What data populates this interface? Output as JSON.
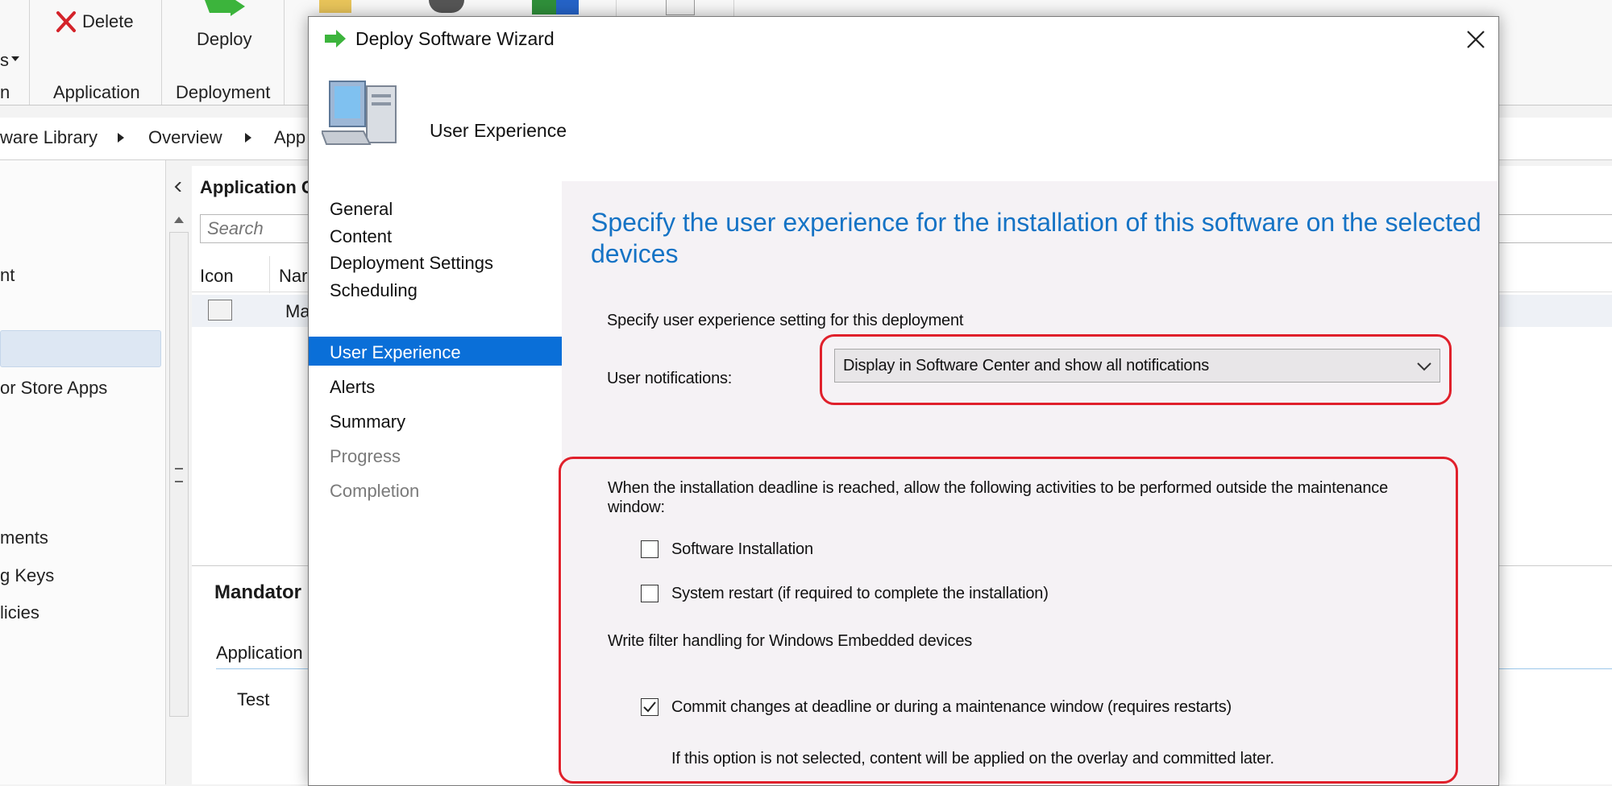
{
  "console": {
    "ribbon": {
      "delete_label": "Delete",
      "deploy_label": "Deploy",
      "left_edge_label": "s",
      "group_left": "n",
      "group_application": "Application",
      "group_deployment": "Deployment"
    },
    "breadcrumb": {
      "item1": "ware Library",
      "item2": "Overview",
      "item3": "App"
    },
    "nav": {
      "items": [
        "nt",
        "or Store Apps",
        "ments",
        "g Keys",
        "licies"
      ]
    },
    "list": {
      "title": "Application C",
      "search_placeholder": "Search",
      "col_icon": "Icon",
      "col_name": "Nar",
      "row_name": "Ma",
      "detail_title": "Mandator",
      "detail_tab": "Application",
      "detail_value": "Test"
    }
  },
  "wizard": {
    "title": "Deploy Software Wizard",
    "header_title": "User Experience",
    "steps": [
      {
        "label": "General",
        "state": "done"
      },
      {
        "label": "Content",
        "state": "done"
      },
      {
        "label": "Deployment Settings",
        "state": "done"
      },
      {
        "label": "Scheduling",
        "state": "done"
      },
      {
        "label": "User Experience",
        "state": "current"
      },
      {
        "label": "Alerts",
        "state": "pending"
      },
      {
        "label": "Summary",
        "state": "pending"
      },
      {
        "label": "Progress",
        "state": "disabled"
      },
      {
        "label": "Completion",
        "state": "disabled"
      }
    ],
    "page": {
      "heading": "Specify the user experience for the installation of this software on the selected devices",
      "section_label": "Specify user experience setting for this deployment",
      "notifications_label": "User notifications:",
      "notifications_value": "Display in Software Center and show all notifications",
      "deadline_text_line1": "When the installation deadline is reached, allow the following activities to be performed outside the maintenance",
      "deadline_text_line2": "window:",
      "software_installation": {
        "label": "Software Installation",
        "checked": false
      },
      "system_restart": {
        "label": "System restart  (if required to complete the installation)",
        "checked": false
      },
      "write_filter_label": "Write filter handling for Windows Embedded devices",
      "commit_changes": {
        "label": "Commit changes at deadline or during a maintenance window (requires restarts)",
        "checked": true
      },
      "commit_note": "If this option is not selected, content will be applied on the overlay and committed later."
    }
  },
  "colors": {
    "heading_blue": "#1573c5",
    "selection_blue": "#0a6fd8",
    "highlight_red": "#e0202b"
  }
}
